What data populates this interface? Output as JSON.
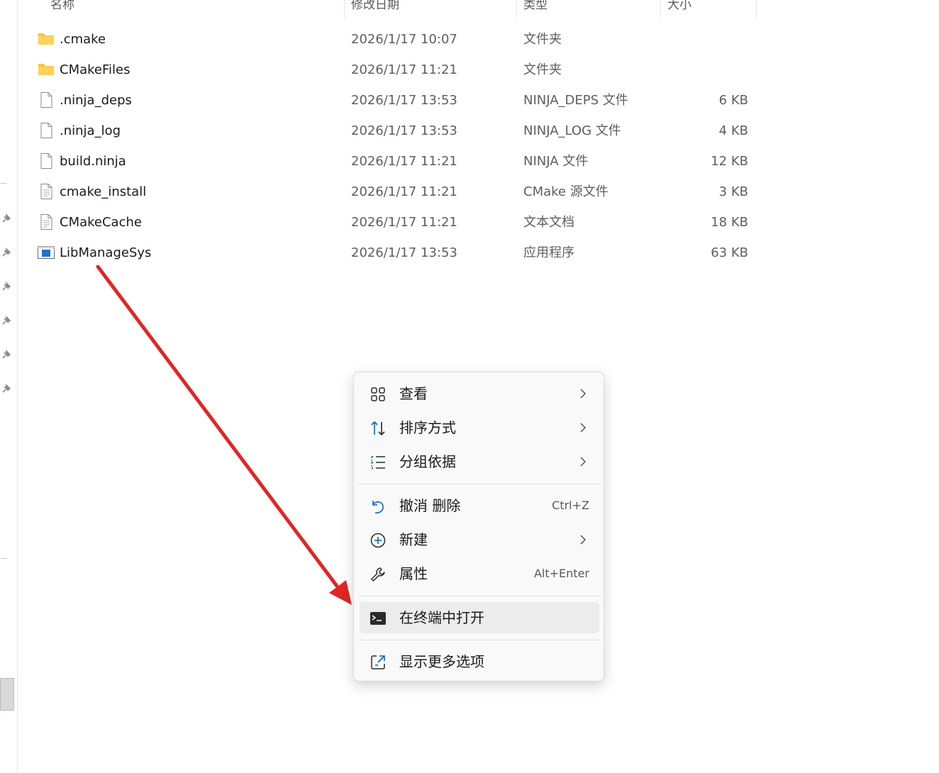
{
  "header": {
    "name_label": "名称",
    "date_label": "修改日期",
    "type_label": "类型",
    "size_label": "大小"
  },
  "files": [
    {
      "name": ".cmake",
      "date": "2026/1/17 10:07",
      "type": "文件夹",
      "size": "",
      "icon": "folder-icon"
    },
    {
      "name": "CMakeFiles",
      "date": "2026/1/17 11:21",
      "type": "文件夹",
      "size": "",
      "icon": "folder-icon"
    },
    {
      "name": ".ninja_deps",
      "date": "2026/1/17 13:53",
      "type": "NINJA_DEPS 文件",
      "size": "6 KB",
      "icon": "file-icon"
    },
    {
      "name": ".ninja_log",
      "date": "2026/1/17 13:53",
      "type": "NINJA_LOG 文件",
      "size": "4 KB",
      "icon": "file-icon"
    },
    {
      "name": "build.ninja",
      "date": "2026/1/17 11:21",
      "type": "NINJA 文件",
      "size": "12 KB",
      "icon": "file-icon"
    },
    {
      "name": "cmake_install",
      "date": "2026/1/17 11:21",
      "type": "CMake 源文件",
      "size": "3 KB",
      "icon": "text-file-icon"
    },
    {
      "name": "CMakeCache",
      "date": "2026/1/17 11:21",
      "type": "文本文档",
      "size": "18 KB",
      "icon": "text-file-icon"
    },
    {
      "name": "LibManageSys",
      "date": "2026/1/17 13:53",
      "type": "应用程序",
      "size": "63 KB",
      "icon": "app-icon"
    }
  ],
  "context_menu": {
    "view": {
      "label": "查看"
    },
    "sort": {
      "label": "排序方式"
    },
    "group": {
      "label": "分组依据"
    },
    "undo": {
      "label": "撤消 删除",
      "shortcut": "Ctrl+Z"
    },
    "new": {
      "label": "新建"
    },
    "properties": {
      "label": "属性",
      "shortcut": "Alt+Enter"
    },
    "terminal": {
      "label": "在终端中打开"
    },
    "more": {
      "label": "显示更多选项"
    }
  },
  "colors": {
    "folder": "#f8c33c",
    "annotation_arrow": "#e02626",
    "accent": "#0067c0"
  }
}
